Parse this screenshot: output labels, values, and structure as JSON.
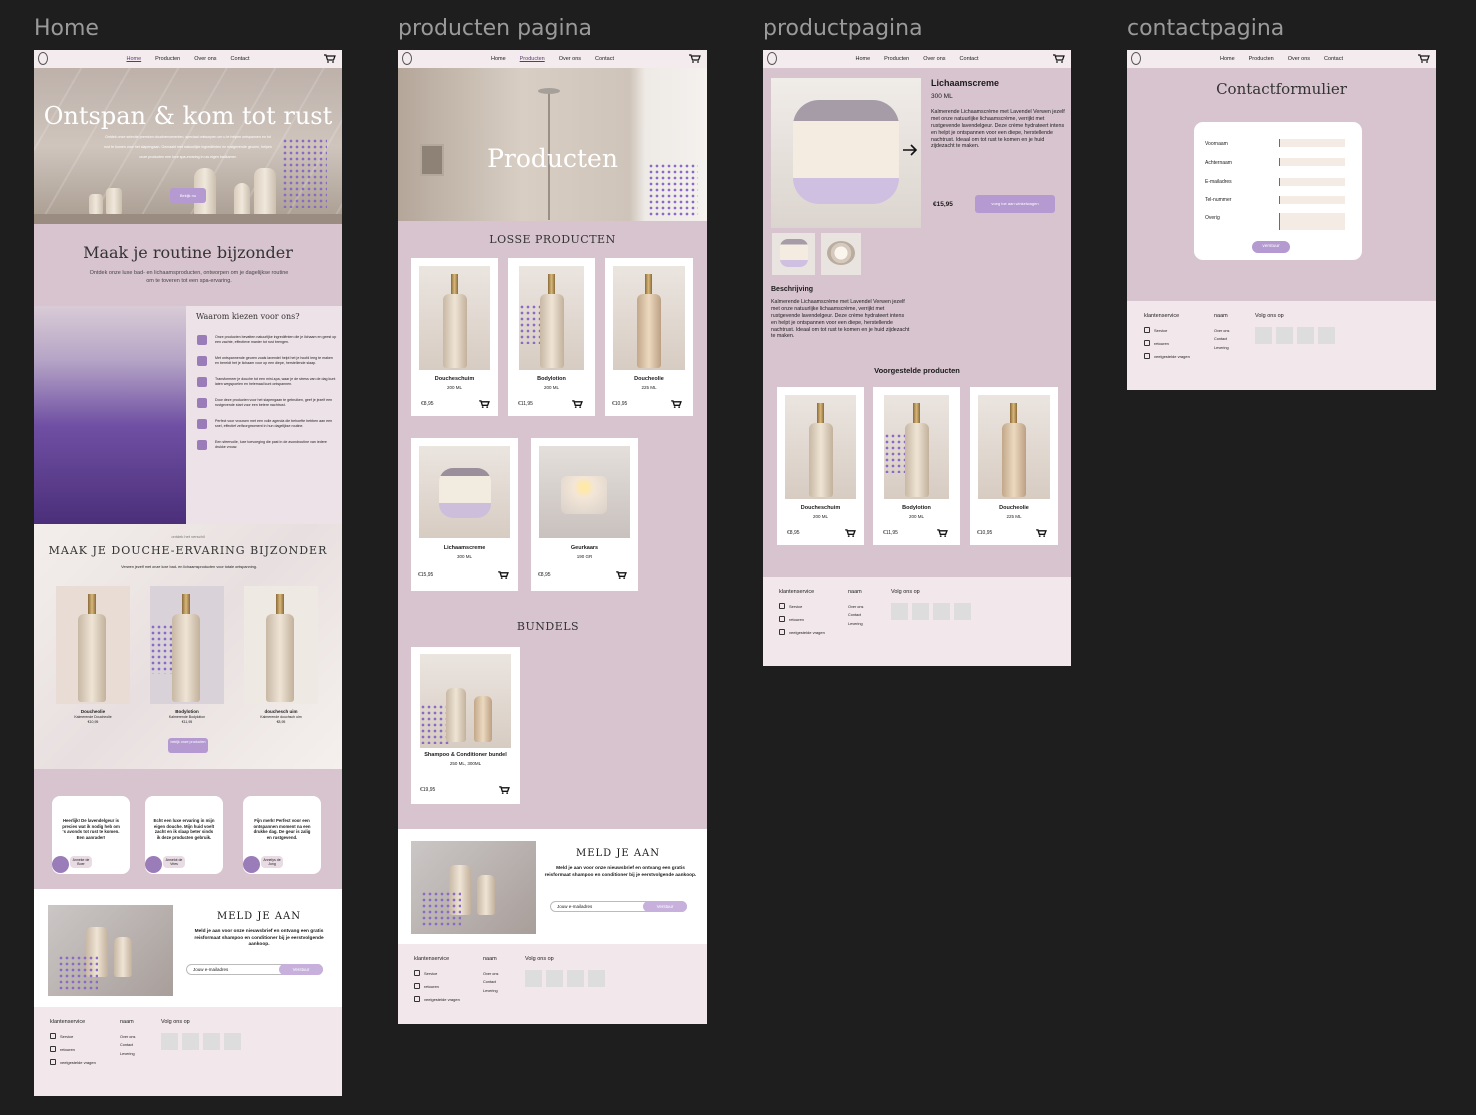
{
  "frames": {
    "home": "Home",
    "producten": "producten pagina",
    "product": "productpagina",
    "contact": "contactpagina"
  },
  "nav": {
    "home": "Home",
    "producten": "Producten",
    "over_ons": "Over ons",
    "contact": "Contact"
  },
  "home": {
    "hero_title": "Ontspan & kom tot rust",
    "hero_text_1": "Ontdek onze selectie premium douchemomenten, speciaal ontworpen om u te helpen ontspannen en tot",
    "hero_text_2": "rust te komen voor het slapengaan. Gemaakt met natuurlijke ingrediënten en rustgevende geuren, helpen",
    "hero_text_3": "onze producten een luxe spa-ervaring in uw eigen badkamer.",
    "hero_button": "Bekijk nu",
    "routine_title": "Maak je routine bijzonder",
    "routine_text": "Ontdek onze luxe bad- en lichaamsproducten, ontworpen om je dagelijkse routine om te toveren tot een spa-ervaring.",
    "why_title": "Waarom kiezen voor ons?",
    "why_items": [
      "Onze producten bevatten natuurlijke ingrediënten die je lichaam en geest op een zachte, effectieve manier tot rust brengen.",
      "Met ontspannende geuren zoals lavendel helpt het je hoofd leeg te maken en bereidt het je lichaam voor op een diepe, herstellende slaap.",
      "Transformeer je douche tot een mini-spa, waar je de stress van de dag kunt laten wegspoelen en helemaal kunt ontspannen.",
      "Door deze producten voor het slapengaan te gebruiken, geef je jezelf een rustgevende start voor een betere nachtrust.",
      "Perfect voor vrouwen met een volle agenda die behoefte hebben aan een snel, effectief zelfzorgmoment in hun dagelijkse routine.",
      "Een sfeervolle, luxe toevoeging die past in de avondroutine van iedere drukke vrouw."
    ],
    "showcase_kicker": "ontdek het verschil",
    "showcase_title": "Maak je douche-ervaring bijzonder",
    "showcase_text": "Verwen jezelf met onze luxe bad- en lichaamsproducten voor totale ontspanning.",
    "showcase_products": [
      {
        "name": "Doucheolie",
        "sub": "Kalmerende Doucheolie",
        "price": "€10,95"
      },
      {
        "name": "Bodylotion",
        "sub": "Kalmerende Bodylotion",
        "price": "€11,95"
      },
      {
        "name": "douchesch uim",
        "sub": "Kalmerende douchsch uim",
        "price": "€8,95"
      }
    ],
    "showcase_button": "bekijk onze producten",
    "reviews": [
      {
        "text": "Heerlijk! De lavendelgeur is precies wat ik nodig heb om 's avonds tot rust te komen. Een aanrader!",
        "name": "Anneke de Boer"
      },
      {
        "text": "Echt een luxe ervaring in mijn eigen douche. Mijn huid voelt zacht en ik slaap beter sinds ik deze producten gebruik.",
        "name": "Annelot de Vries"
      },
      {
        "text": "Fijn merk! Perfect voor een ontspannen moment na een drukke dag. De geur is zalig en rustgevend.",
        "name": "Annelys de Jong"
      }
    ]
  },
  "newsletter": {
    "title": "Meld je aan",
    "text": "Meld je aan voor onze nieuwsbrief en ontvang een gratis reisformaat shampoo en conditioner bij je eerstvolgende aankoop.",
    "placeholder": "Jouw e-mailadres",
    "button": "Verstuur"
  },
  "footer": {
    "col1_title": "klantenservice",
    "col1_items": [
      "Service",
      "retouren",
      "veelgestelde vragen"
    ],
    "col2_title": "naam",
    "col2_items": [
      "Over ons",
      "Contact",
      "Levering"
    ],
    "col3_title": "Volg ons op"
  },
  "producten": {
    "hero_title": "Producten",
    "section1": "Losse producten",
    "section2": "Bundels",
    "products": [
      {
        "name": "Doucheschuim",
        "size": "200 ML",
        "price": "€8,95"
      },
      {
        "name": "Bodylotion",
        "size": "200 ML",
        "price": "€11,95"
      },
      {
        "name": "Doucheolie",
        "size": "225 ML",
        "price": "€10,95"
      },
      {
        "name": "Lichaamscreme",
        "size": "300 ML",
        "price": "€15,95"
      },
      {
        "name": "Geurkaars",
        "size": "190 GR",
        "price": "€8,95"
      }
    ],
    "bundle": {
      "name": "Shampoo & Conditioner bundel",
      "size": "250 ML, 300ML",
      "price": "€19,95"
    }
  },
  "product": {
    "title": "Lichaamscreme",
    "size": "300 ML",
    "short_desc": "Kalmerende Lichaamscrème met Lavendel Verwen jezelf met onze natuurlijke lichaamscrème, verrijkt met rustgevende lavendelgeur. Deze crème hydrateert intens en helpt je ontspannen voor een diepe, herstellende nachtrust. Ideaal om tot rust te komen en je huid zijdezacht te maken.",
    "price": "€15,95",
    "cart_button": "voeg toe aan winkelwagen",
    "desc_title": "Beschrijving",
    "desc": "Kalmerende Lichaamscrème met Lavendel Verwen jezelf met onze natuurlijke lichaamscrème, verrijkt met rustgevende lavendelgeur. Deze crème hydrateert intens en helpt je ontspannen voor een diepe, herstellende nachtrust. Ideaal om tot rust te komen en je huid zijdezacht te maken.",
    "suggested_title": "Voorgestelde producten",
    "suggested": [
      {
        "name": "Doucheschuim",
        "size": "200 ML",
        "price": "€8,95"
      },
      {
        "name": "Bodylotion",
        "size": "200 ML",
        "price": "€11,95"
      },
      {
        "name": "Doucheolie",
        "size": "225 ML",
        "price": "€10,95"
      }
    ]
  },
  "contact": {
    "title": "Contactformulier",
    "fields": [
      "Voornaam",
      "Achternaam",
      "E-mailadres",
      "Tel-nummer",
      "Overig"
    ],
    "button": "verstuur"
  },
  "colors": {
    "canvas": "#1e1e1e",
    "page_bg": "#d8c4cf",
    "nav_bg": "#f4ebee",
    "accent": "#b49ad0",
    "footer_bg": "#f2e8ec"
  }
}
